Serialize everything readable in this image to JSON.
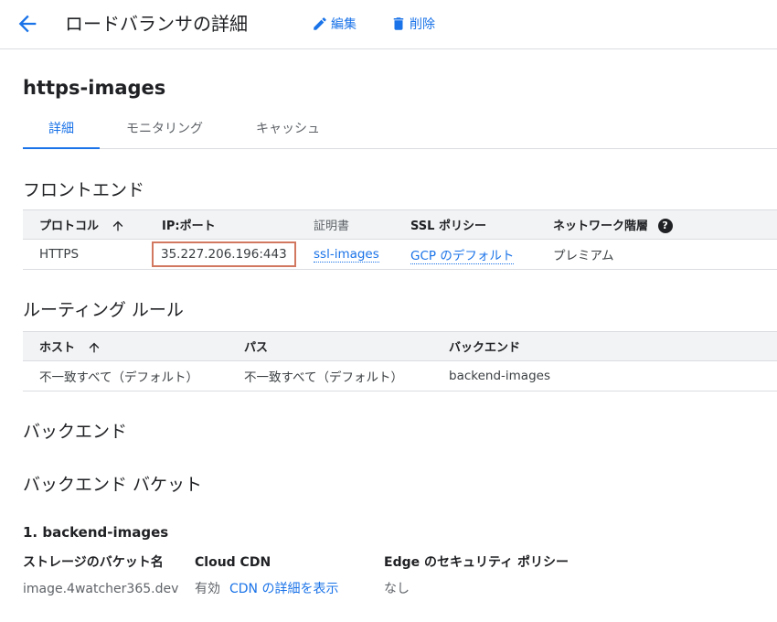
{
  "header": {
    "title": "ロードバランサの詳細",
    "edit_label": "編集",
    "delete_label": "削除"
  },
  "lb_name": "https-images",
  "tabs": [
    {
      "label": "詳細"
    },
    {
      "label": "モニタリング"
    },
    {
      "label": "キャッシュ"
    }
  ],
  "frontend": {
    "title": "フロントエンド",
    "headers": {
      "protocol": "プロトコル",
      "ip_port": "IP:ポート",
      "certificate": "証明書",
      "ssl_policy": "SSL ポリシー",
      "network_tier": "ネットワーク階層"
    },
    "row": {
      "protocol": "HTTPS",
      "ip_port": "35.227.206.196:443",
      "certificate": "ssl-images",
      "ssl_policy": "GCP のデフォルト",
      "network_tier": "プレミアム"
    }
  },
  "routing": {
    "title": "ルーティング ルール",
    "headers": {
      "host": "ホスト",
      "path": "パス",
      "backend": "バックエンド"
    },
    "row": {
      "host": "不一致すべて（デフォルト）",
      "path": "不一致すべて（デフォルト）",
      "backend": "backend-images"
    }
  },
  "backend_title": "バックエンド",
  "backend_bucket": {
    "title": "バックエンド バケット",
    "item_heading": "1. backend-images",
    "labels": {
      "bucket_name": "ストレージのバケット名",
      "cdn": "Cloud CDN",
      "edge_policy": "Edge のセキュリティ ポリシー"
    },
    "values": {
      "bucket_name": "image.4watcher365.dev",
      "cdn_status": "有効",
      "cdn_link": "CDN の詳細を表示",
      "edge_policy": "なし"
    }
  },
  "colors": {
    "accent": "#1a73e8",
    "highlight_box": "#d27861"
  },
  "icons": [
    "arrow-back-icon",
    "pencil-icon",
    "trash-icon",
    "arrow-up-icon",
    "help-icon"
  ]
}
